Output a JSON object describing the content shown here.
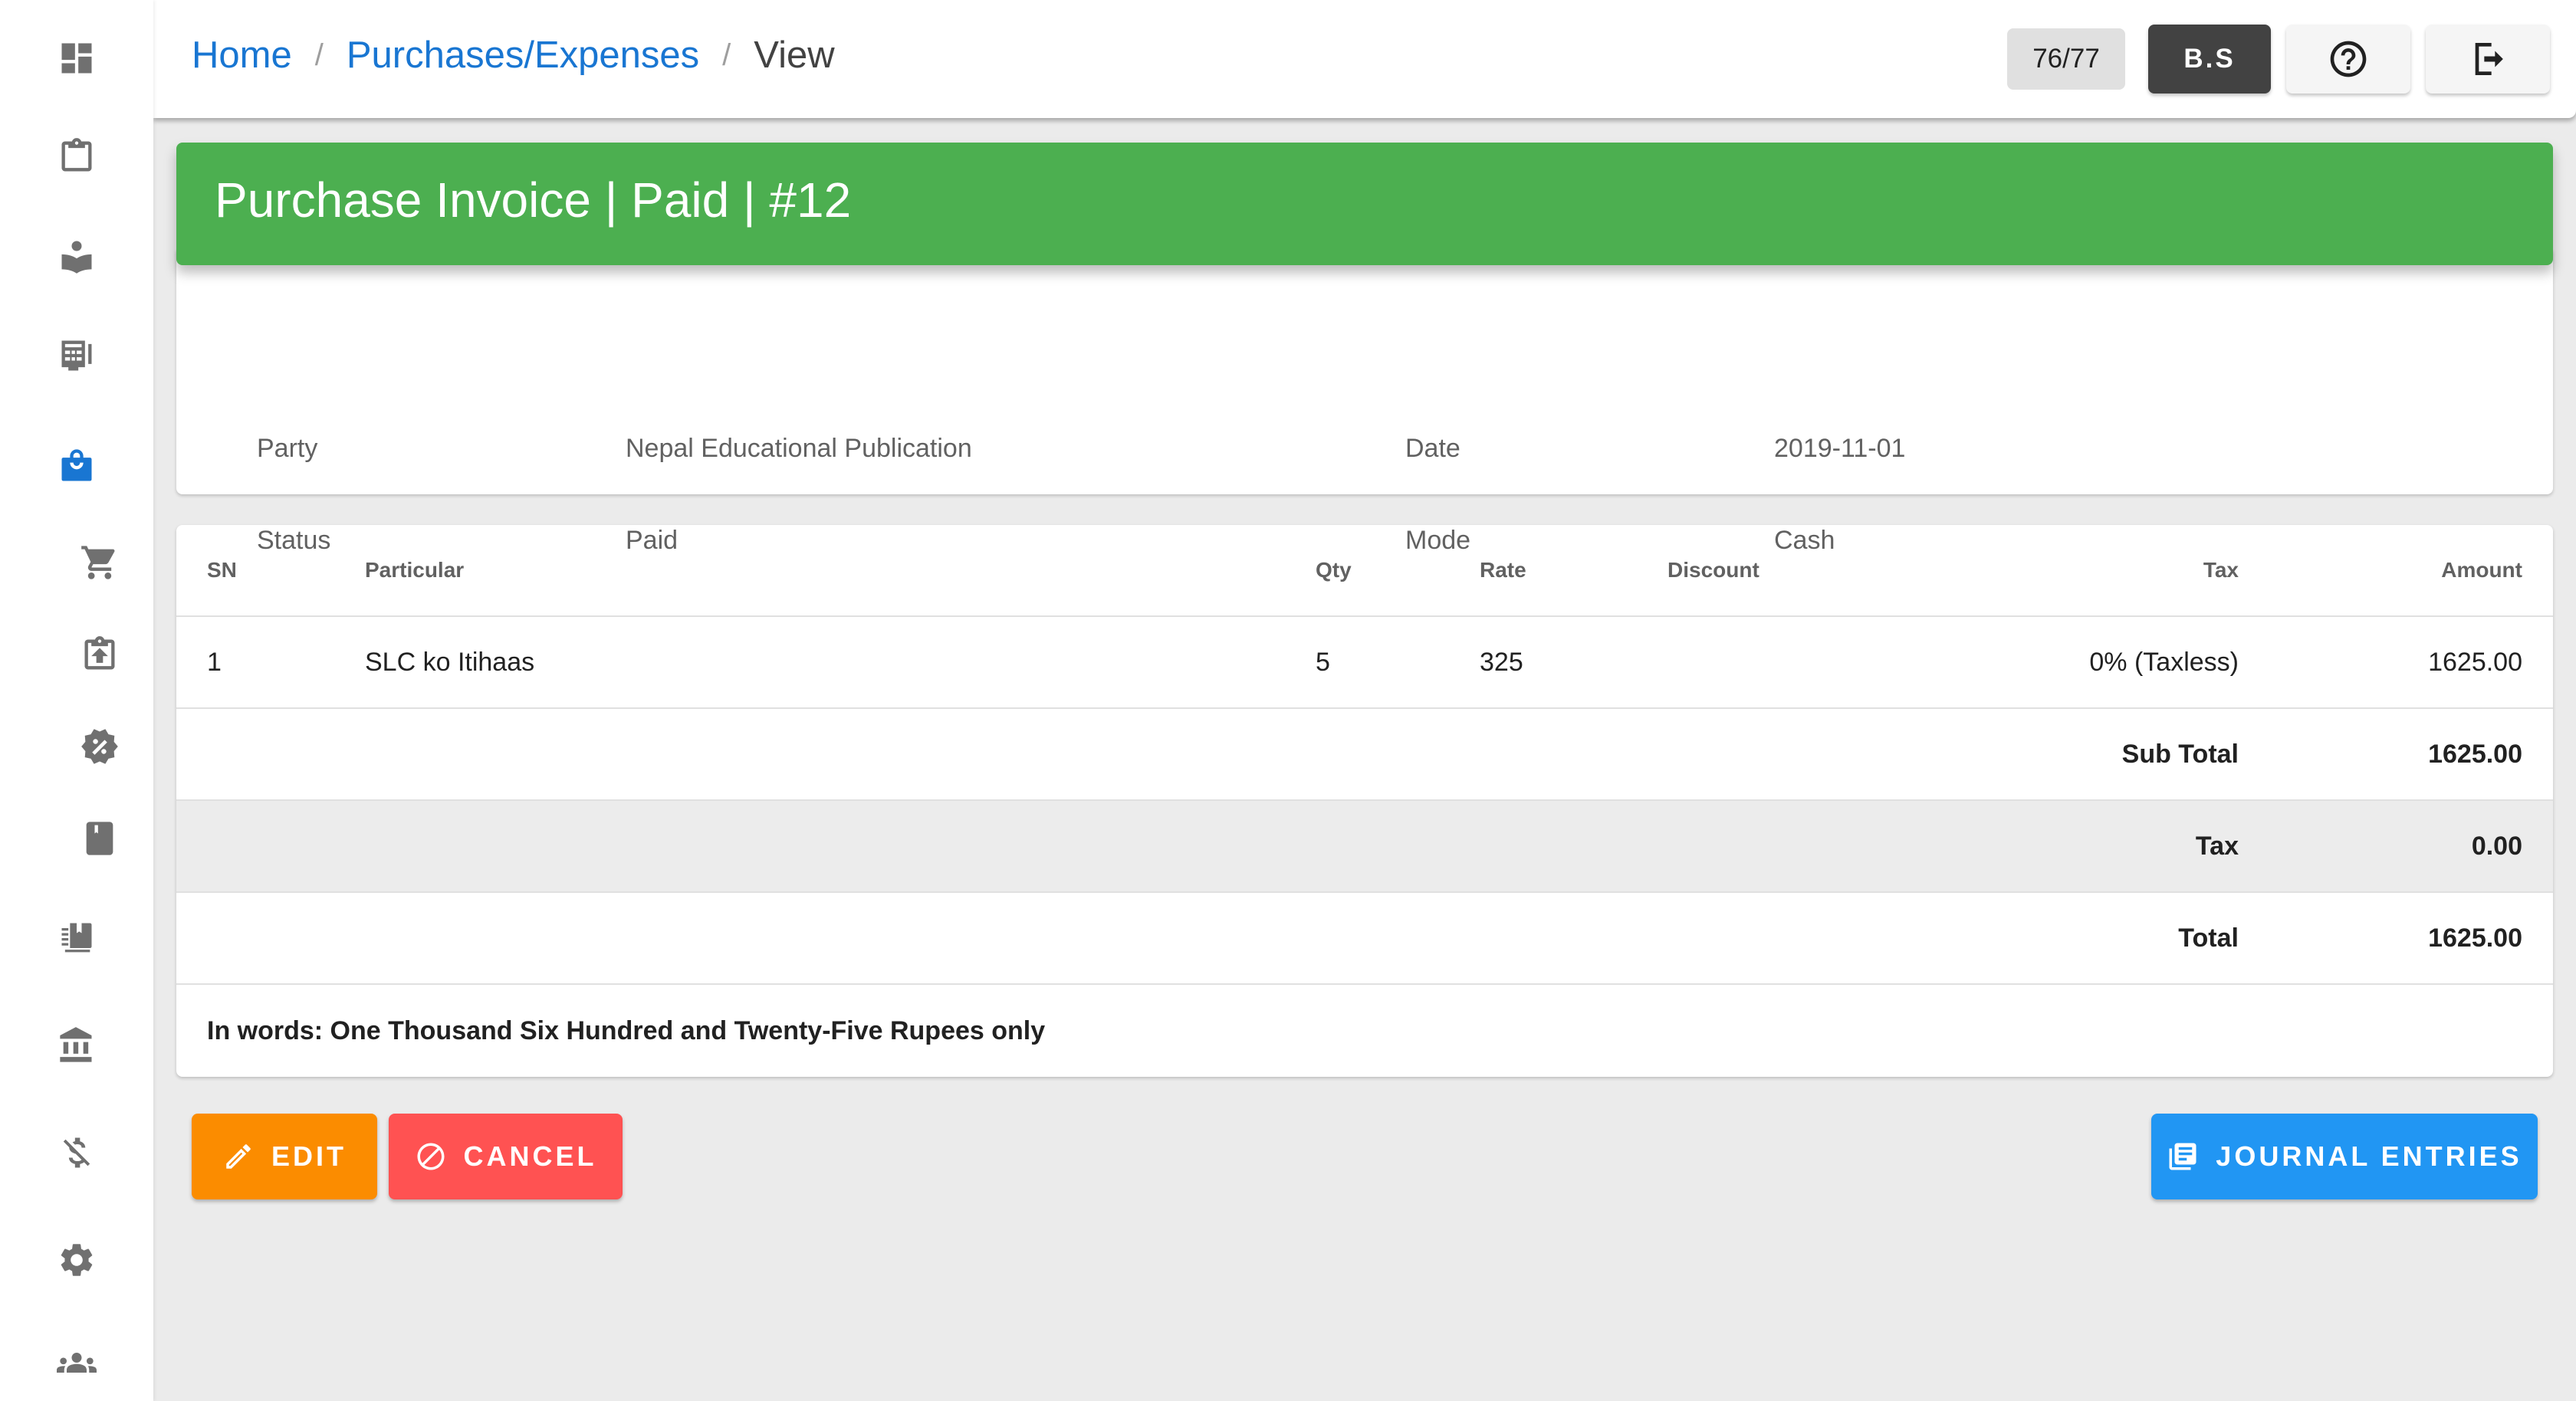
{
  "sidebar": {
    "items": [
      {
        "name": "dashboard",
        "icon": "dashboard-icon",
        "active": false
      },
      {
        "name": "clipboard",
        "icon": "clipboard-icon",
        "active": false
      },
      {
        "name": "reader",
        "icon": "book-reader-icon",
        "active": false
      },
      {
        "name": "pos",
        "icon": "point-of-sale-icon",
        "active": false
      },
      {
        "name": "purchases",
        "icon": "shopping-bag-icon",
        "active": true
      },
      {
        "name": "cart",
        "icon": "shopping-cart-icon",
        "active": false
      },
      {
        "name": "clipboard-upload",
        "icon": "clipboard-upload-icon",
        "active": false
      },
      {
        "name": "discount",
        "icon": "discount-badge-icon",
        "active": false
      },
      {
        "name": "book",
        "icon": "book-icon",
        "active": false
      },
      {
        "name": "ledger",
        "icon": "ledger-book-icon",
        "active": false
      },
      {
        "name": "bank",
        "icon": "bank-icon",
        "active": false
      },
      {
        "name": "no-money",
        "icon": "money-off-icon",
        "active": false
      },
      {
        "name": "settings",
        "icon": "gear-icon",
        "active": false
      },
      {
        "name": "users",
        "icon": "people-icon",
        "active": false
      }
    ]
  },
  "breadcrumb": {
    "items": [
      "Home",
      "Purchases/Expenses"
    ],
    "separator": "/",
    "current": "View"
  },
  "topbar": {
    "counter": "76/77",
    "calendar_toggle": "B.S",
    "help_icon": "help-circle-icon",
    "logout_icon": "logout-icon"
  },
  "invoice": {
    "title": "Purchase Invoice | Paid | #12",
    "header_color": "#4caf50",
    "fields": {
      "party_label": "Party",
      "party_value": "Nepal Educational Publication",
      "date_label": "Date",
      "date_value": "2019-11-01",
      "status_label": "Status",
      "status_value": "Paid",
      "mode_label": "Mode",
      "mode_value": "Cash"
    }
  },
  "table": {
    "headers": {
      "sn": "SN",
      "particular": "Particular",
      "qty": "Qty",
      "rate": "Rate",
      "discount": "Discount",
      "tax": "Tax",
      "amount": "Amount"
    },
    "rows": [
      {
        "sn": "1",
        "particular": "SLC ko Itihaas",
        "qty": "5",
        "rate": "325",
        "discount": "",
        "tax": "0% (Taxless)",
        "amount": "1625.00"
      }
    ],
    "summary": {
      "subtotal_label": "Sub Total",
      "subtotal_value": "1625.00",
      "tax_label": "Tax",
      "tax_value": "0.00",
      "total_label": "Total",
      "total_value": "1625.00"
    },
    "in_words": "In words: One Thousand Six Hundred and Twenty-Five Rupees only"
  },
  "actions": {
    "edit_label": "EDIT",
    "edit_color": "#fb8c00",
    "cancel_label": "CANCEL",
    "cancel_color": "#ff5252",
    "journal_label": "JOURNAL ENTRIES",
    "journal_color": "#2196f3"
  }
}
